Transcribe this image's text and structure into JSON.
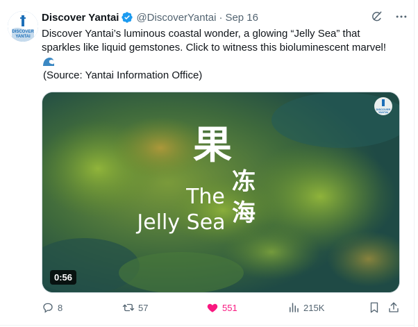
{
  "tweet": {
    "display_name": "Discover Yantai",
    "handle": "@DiscoverYantai",
    "separator": "·",
    "date": "Sep 16",
    "text_line1": "Discover Yantai’s luminous coastal wonder, a glowing “Jelly Sea” that",
    "text_line2": "sparkles like liquid gemstones. Click to witness this bioluminescent marvel!",
    "source": "(Source: Yantai Information Office)",
    "avatar_text": "DISCOVER YANTAI"
  },
  "media": {
    "overlay_cn_top": "果",
    "overlay_cn_mid": "冻",
    "overlay_cn_bottom": "海",
    "overlay_en_line1": "The",
    "overlay_en_line2": "Jelly Sea",
    "watermark_text": "DISCOVER YANTAI",
    "duration": "0:56"
  },
  "actions": {
    "replies": "8",
    "retweets": "57",
    "likes": "551",
    "views": "215K"
  },
  "colors": {
    "accent": "#1d9bf0",
    "like": "#f91880",
    "muted": "#536471",
    "text": "#0f1419"
  },
  "icons": [
    "verified-badge-icon",
    "grok-icon",
    "more-icon",
    "wave-emoji-icon",
    "reply-icon",
    "retweet-icon",
    "like-icon",
    "views-icon",
    "bookmark-icon",
    "share-icon"
  ]
}
